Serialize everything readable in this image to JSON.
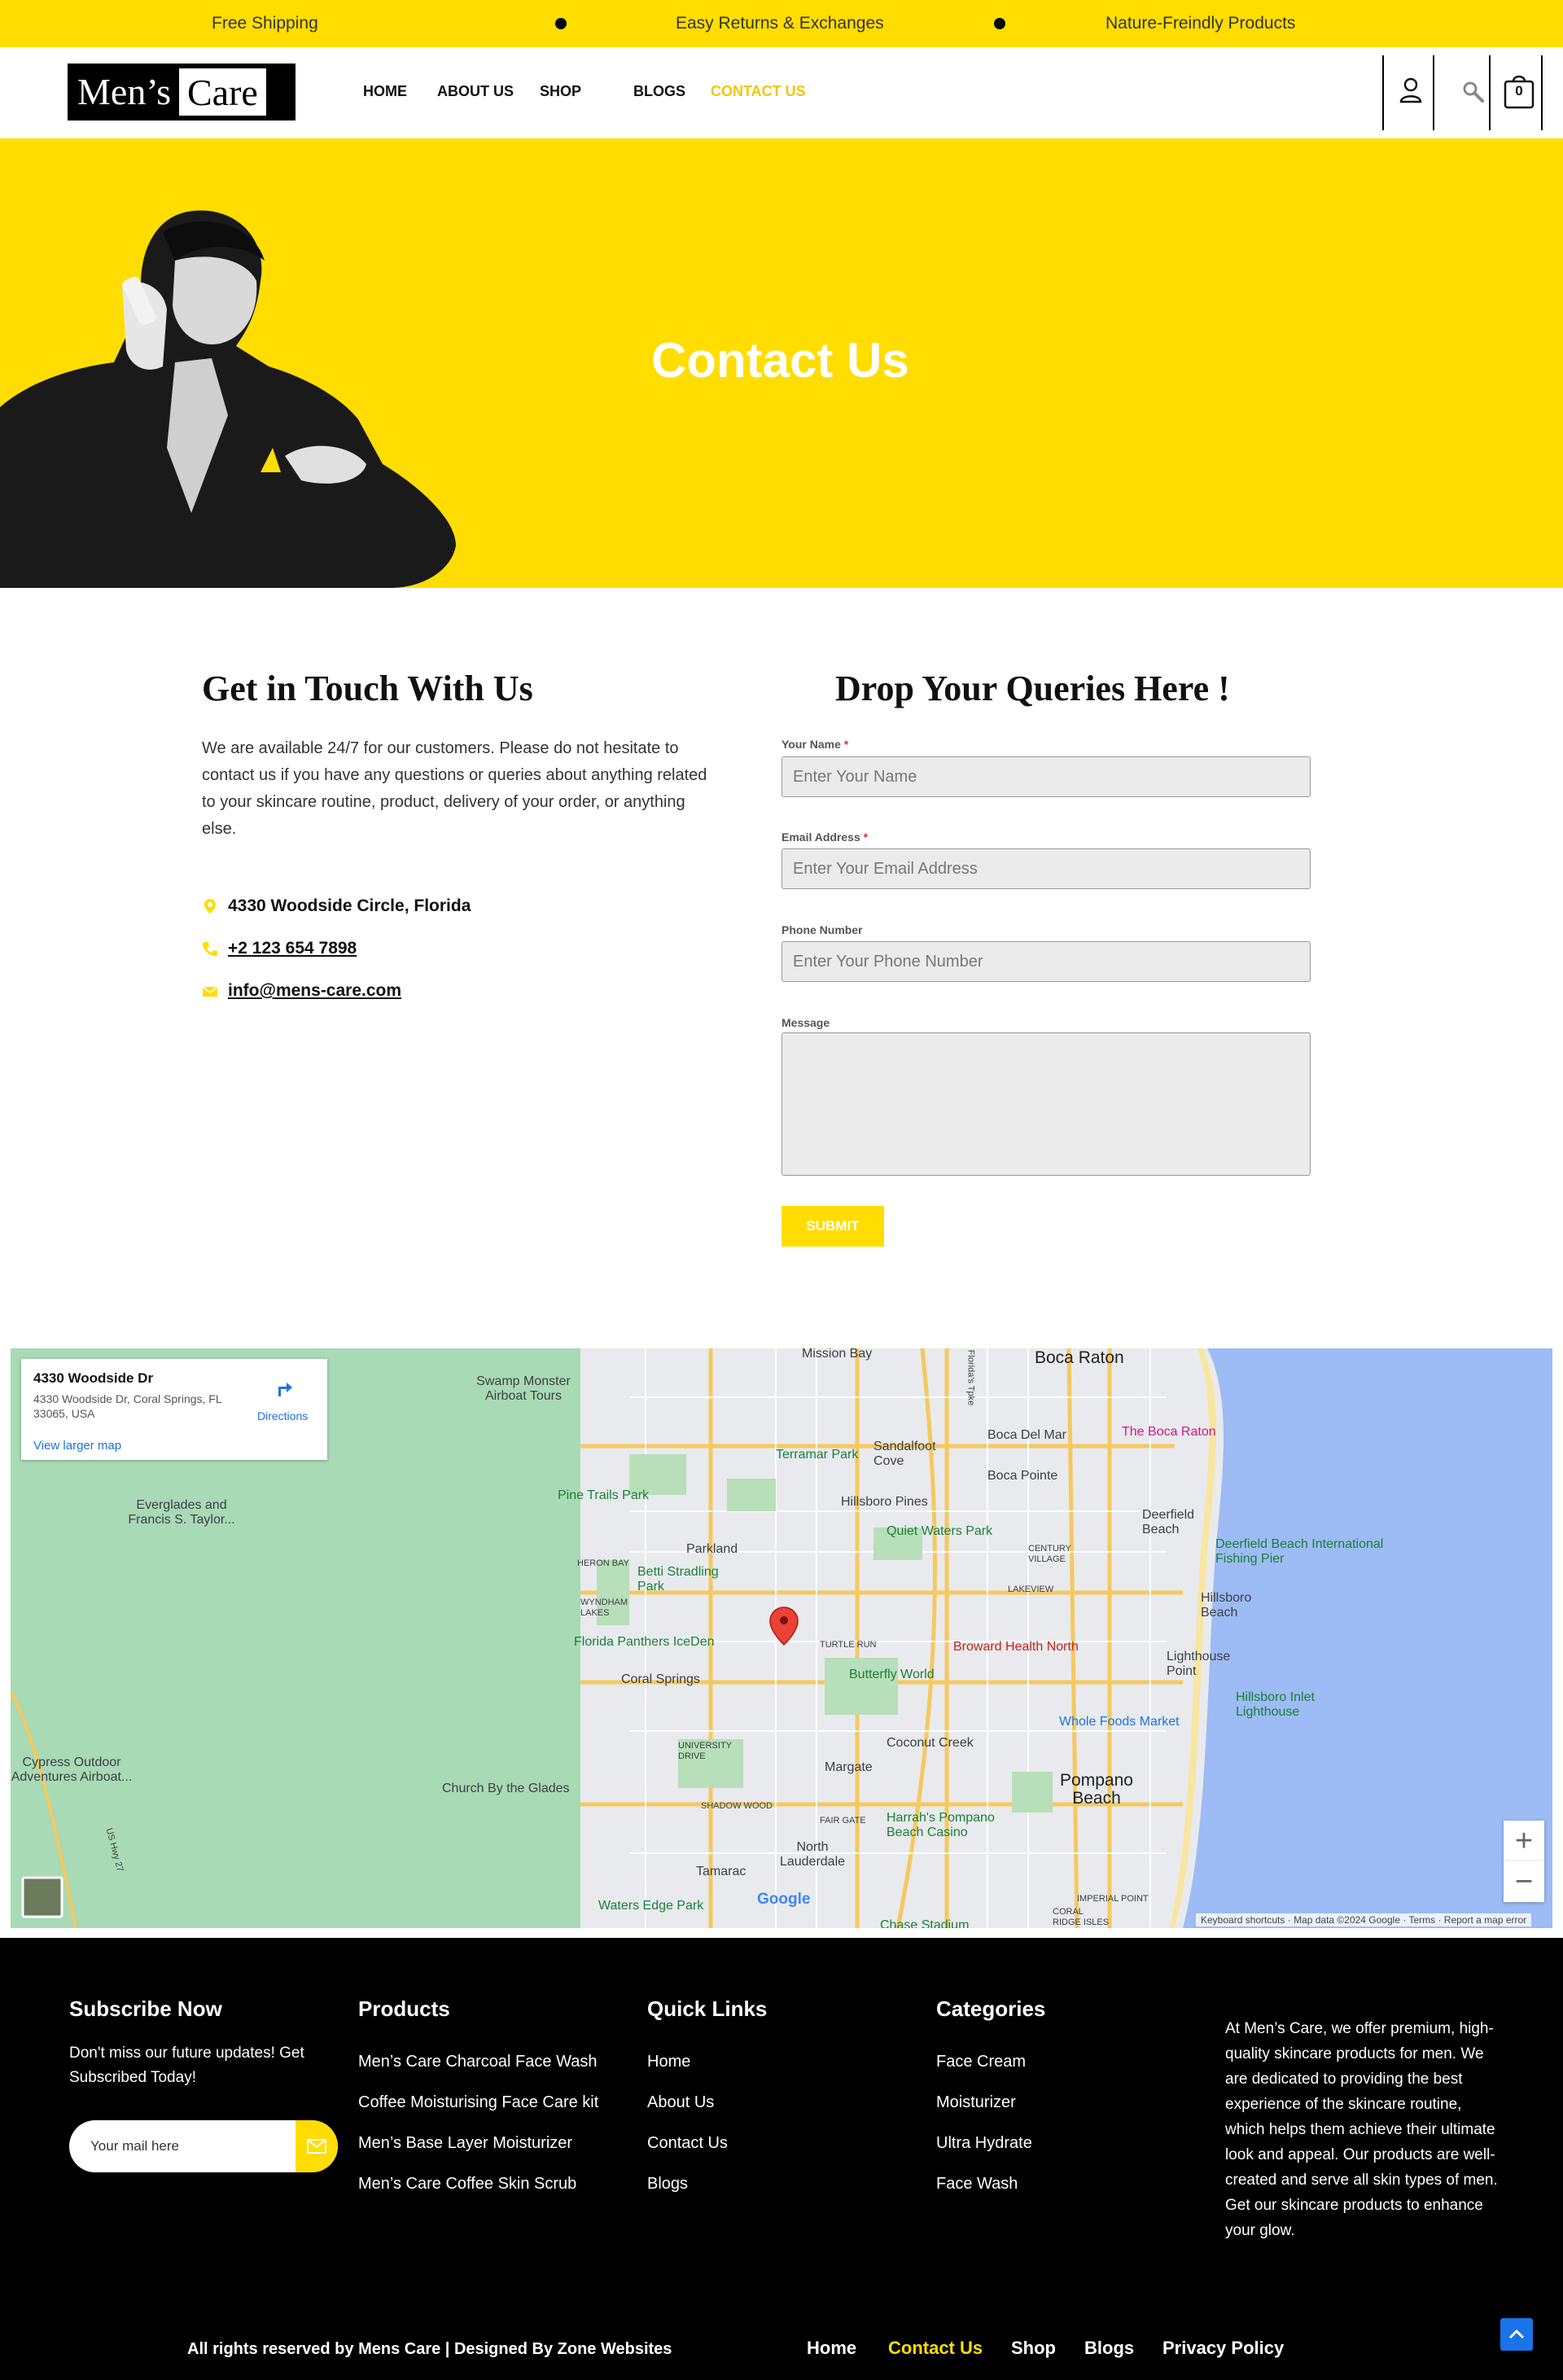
{
  "topbar": {
    "items": [
      "Free Shipping",
      "Easy Returns & Exchanges",
      "Nature-Freindly Products"
    ]
  },
  "header": {
    "logo_part1": "Men’s",
    "logo_part2": "Care",
    "nav": [
      "HOME",
      "ABOUT US",
      "SHOP",
      "BLOGS",
      "CONTACT US"
    ],
    "active_nav": "CONTACT US",
    "cart_count": "0",
    "icons": [
      "user-icon",
      "search-icon",
      "cart-icon"
    ]
  },
  "hero": {
    "title": "Contact Us"
  },
  "contact": {
    "title": "Get in Touch With Us",
    "paragraph": "We are available 24/7 for our customers. Please do not hesitate to contact us if you have any questions or queries about anything related to your skincare routine, product, delivery of your order, or anything else.",
    "address": "4330 Woodside Circle, Florida",
    "phone": "+2 123 654 7898",
    "email": "info@mens-care.com"
  },
  "form": {
    "title": "Drop Your Queries Here !",
    "name_label": "Your Name",
    "name_placeholder": "Enter Your Name",
    "email_label": "Email Address",
    "email_placeholder": "Enter Your Email Address",
    "phone_label": "Phone Number",
    "phone_placeholder": "Enter Your Phone Number",
    "message_label": "Message",
    "required_mark": "*",
    "submit_label": "SUBMIT"
  },
  "map": {
    "card_title": "4330 Woodside Dr",
    "card_address": "4330 Woodside Dr, Coral Springs, FL 33065, USA",
    "directions": "Directions",
    "larger_map": "View larger map",
    "labels": {
      "boca_raton": "Boca Raton",
      "mission_bay": "Mission Bay",
      "boca_del_mar": "Boca Del Mar",
      "the_boca_raton": "The Boca Raton",
      "sandalfoot_cove": "Sandalfoot Cove",
      "boca_pointe": "Boca Pointe",
      "terramar_park": "Terramar Park",
      "hillsboro_pines": "Hillsboro Pines",
      "deerfield_beach": "Deerfield Beach",
      "deerfield_pier": "Deerfield Beach International Fishing Pier",
      "swamp_monster": "Swamp Monster Airboat Tours",
      "everglades": "Everglades and Francis S. Taylor...",
      "pine_trails": "Pine Trails Park",
      "parkland": "Parkland",
      "quiet_waters": "Quiet Waters Park",
      "century_village": "CENTURY VILLAGE",
      "heron_bay": "HERON BAY",
      "betti_stradling": "Betti Stradling Park",
      "lakeview": "LAKEVIEW",
      "hillsboro_beach": "Hillsboro Beach",
      "wyndham_lakes": "WYNDHAM LAKES",
      "florida_panthers": "Florida Panthers IceDen",
      "turtle_run": "TURTLE RUN",
      "broward_health": "Broward Health North",
      "lighthouse_point": "Lighthouse Point",
      "coral_springs": "Coral Springs",
      "butterfly_world": "Butterfly World",
      "hillsboro_inlet": "Hillsboro Inlet Lighthouse",
      "whole_foods": "Whole Foods Market",
      "cypress_outdoor": "Cypress Outdoor Adventures Airboat...",
      "coconut_creek": "Coconut Creek",
      "university_drive": "UNIVERSITY DRIVE",
      "church_glades": "Church By the Glades",
      "margate": "Margate",
      "pompano_beach": "Pompano Beach",
      "shadow_wood": "SHADOW WOOD",
      "fair_gate": "FAIR GATE",
      "harrahs": "Harrah's Pompano Beach Casino",
      "north_lauderdale": "North Lauderdale",
      "tamarac": "Tamarac",
      "imperial_point": "IMPERIAL POINT",
      "coral_ridge_isles": "CORAL RIDGE ISLES",
      "waters_edge": "Waters Edge Park",
      "chase_stadium": "Chase Stadium",
      "us_hwy_27": "US Hwy 27",
      "florida_tpke": "Florida's Tpke"
    },
    "zoom_in": "+",
    "zoom_out": "−",
    "google": "Google",
    "attribution": [
      "Keyboard shortcuts",
      "Map data ©2024 Google",
      "Terms",
      "Report a map error"
    ]
  },
  "footer": {
    "subscribe_title": "Subscribe Now",
    "subscribe_text": "Don't miss our future updates! Get Subscribed Today!",
    "mail_placeholder": "Your mail here",
    "products_title": "Products",
    "products": [
      "Men’s Care Charcoal Face Wash",
      "Coffee Moisturising Face Care kit",
      "Men’s Base Layer Moisturizer",
      "Men’s Care Coffee Skin Scrub"
    ],
    "quicklinks_title": "Quick Links",
    "quicklinks": [
      "Home",
      "About Us",
      "Contact Us",
      "Blogs"
    ],
    "categories_title": "Categories",
    "categories": [
      "Face Cream",
      "Moisturizer",
      "Ultra Hydrate",
      "Face Wash"
    ],
    "about": "At Men’s Care, we offer premium, high-quality skincare products for men. We are dedicated to providing the best experience of the skincare routine, which helps them achieve their ultimate look and appeal. Our products are well-created and serve all skin types of men. Get our skincare products to enhance your glow.",
    "copyright": "All rights reserved by Mens Care | Designed By Zone Websites",
    "bottom_links": [
      "Home",
      "Contact Us",
      "Shop",
      "Blogs",
      "Privacy Policy"
    ],
    "bottom_active": "Contact Us"
  },
  "colors": {
    "brand_yellow": "#FFDD00",
    "active_link": "#F2C500",
    "footer_bg": "#000000"
  }
}
